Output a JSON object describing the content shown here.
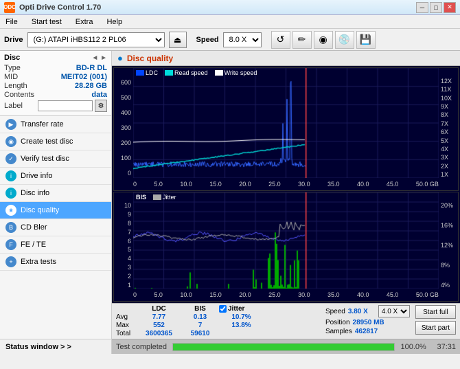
{
  "app": {
    "title": "Opti Drive Control 1.70",
    "icon": "ODC"
  },
  "titlebar": {
    "minimize": "─",
    "maximize": "□",
    "close": "✕"
  },
  "menu": {
    "items": [
      "File",
      "Start test",
      "Extra",
      "Help"
    ]
  },
  "drivebar": {
    "drive_label": "Drive",
    "drive_value": "(G:)  ATAPI iHBS112  2 PL06",
    "speed_label": "Speed",
    "speed_value": "8.0 X",
    "eject_icon": "⏏",
    "icons": [
      "💾",
      "✏️",
      "📀",
      "💿",
      "💾"
    ]
  },
  "disc_panel": {
    "title": "Disc",
    "arrows": "◄ ►",
    "fields": [
      {
        "key": "Type",
        "val": "BD-R DL"
      },
      {
        "key": "MID",
        "val": "MEIT02 (001)"
      },
      {
        "key": "Length",
        "val": "28.28 GB"
      },
      {
        "key": "Contents",
        "val": "data"
      },
      {
        "key": "Label",
        "val": ""
      }
    ]
  },
  "nav": {
    "items": [
      {
        "id": "transfer-rate",
        "label": "Transfer rate",
        "active": false
      },
      {
        "id": "create-test-disc",
        "label": "Create test disc",
        "active": false
      },
      {
        "id": "verify-test-disc",
        "label": "Verify test disc",
        "active": false
      },
      {
        "id": "drive-info",
        "label": "Drive info",
        "active": false
      },
      {
        "id": "disc-info",
        "label": "Disc info",
        "active": false
      },
      {
        "id": "disc-quality",
        "label": "Disc quality",
        "active": true
      },
      {
        "id": "cd-bler",
        "label": "CD Bler",
        "active": false
      },
      {
        "id": "fe-te",
        "label": "FE / TE",
        "active": false
      },
      {
        "id": "extra-tests",
        "label": "Extra tests",
        "active": false
      }
    ]
  },
  "status_window": {
    "label": "Status window > >"
  },
  "content": {
    "title": "Disc quality",
    "icon": "●"
  },
  "chart_top": {
    "legend": [
      {
        "label": "LDC",
        "color": "#0044ff"
      },
      {
        "label": "Read speed",
        "color": "#00dddd"
      },
      {
        "label": "Write speed",
        "color": "#ffffff"
      }
    ],
    "y_labels": [
      "600",
      "500",
      "400",
      "300",
      "200",
      "100",
      "0"
    ],
    "y_labels_right": [
      "12X",
      "11X",
      "10X",
      "9X",
      "8X",
      "7X",
      "6X",
      "5X",
      "4X",
      "3X",
      "2X",
      "1X"
    ],
    "x_labels": [
      "0",
      "5.0",
      "10.0",
      "15.0",
      "20.0",
      "25.0",
      "30.0",
      "35.0",
      "40.0",
      "45.0",
      "50.0 GB"
    ]
  },
  "chart_bottom": {
    "title": "BIS",
    "legend_jitter": "Jitter",
    "y_labels": [
      "10",
      "9",
      "8",
      "7",
      "6",
      "5",
      "4",
      "3",
      "2",
      "1"
    ],
    "y_labels_right": [
      "20%",
      "16%",
      "12%",
      "8%",
      "4%"
    ],
    "x_labels": [
      "0",
      "5.0",
      "10.0",
      "15.0",
      "20.0",
      "25.0",
      "30.0",
      "35.0",
      "40.0",
      "45.0",
      "50.0 GB"
    ]
  },
  "stats": {
    "headers": [
      "LDC",
      "BIS",
      "Jitter"
    ],
    "jitter_checked": true,
    "rows": [
      {
        "label": "Avg",
        "ldc": "7.77",
        "bis": "0.13",
        "jitter": "10.7%"
      },
      {
        "label": "Max",
        "ldc": "552",
        "bis": "7",
        "jitter": "13.8%"
      },
      {
        "label": "Total",
        "ldc": "3600365",
        "bis": "59610",
        "jitter": ""
      }
    ],
    "speed_label": "Speed",
    "speed_val": "3.80 X",
    "speed_select": "4.0 X",
    "position_label": "Position",
    "position_val": "28950 MB",
    "samples_label": "Samples",
    "samples_val": "462817",
    "start_full": "Start full",
    "start_part": "Start part"
  },
  "progress": {
    "label": "Test completed",
    "percent": 100.0,
    "percent_text": "100.0%",
    "time": "37:31",
    "fill_color": "#33cc33"
  }
}
